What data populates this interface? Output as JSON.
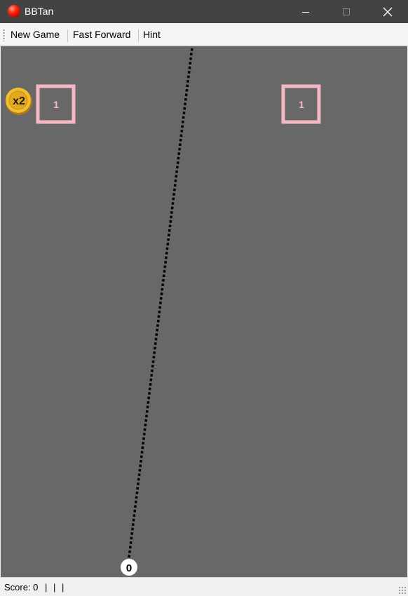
{
  "window": {
    "title": "BBTan",
    "icon": "red-ball-icon",
    "controls": [
      "minimize-icon",
      "maximize-icon",
      "close-icon"
    ]
  },
  "toolbar": {
    "new_game": "New Game",
    "fast_forward": "Fast Forward",
    "hint": "Hint"
  },
  "game": {
    "blocks": [
      {
        "value": "1",
        "color": "#f4b8c4"
      },
      {
        "value": "1",
        "color": "#f4b8c4"
      }
    ],
    "powerup": {
      "label": "x2",
      "color": "#e8b020"
    },
    "ball_count": "0",
    "aim_line_color": "#000000",
    "board_color": "#686868"
  },
  "status": {
    "score_label": "Score: 0",
    "separators": [
      "|",
      "|",
      "|"
    ]
  }
}
